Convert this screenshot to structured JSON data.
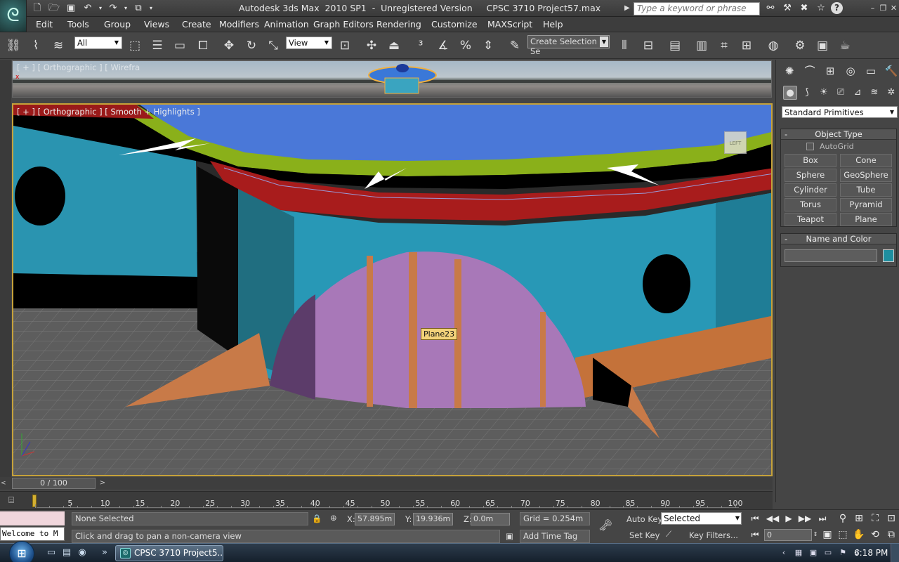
{
  "window": {
    "title": "Autodesk 3ds Max  2010 SP1  -  Unregistered Version     CPSC 3710 Project57.max",
    "search_placeholder": "Type a keyword or phrase",
    "controls": [
      "minimize-icon",
      "restore-icon",
      "close-icon"
    ]
  },
  "quick_access": [
    "new-icon",
    "open-icon",
    "save-icon",
    "undo-icon",
    "redo-icon",
    "project-folder-icon"
  ],
  "title_icons": [
    "binoculars-icon",
    "communication-center-icon",
    "favorites-icon",
    "star-icon",
    "help-icon"
  ],
  "menu": {
    "items": [
      "Edit",
      "Tools",
      "Group",
      "Views",
      "Create",
      "Modifiers",
      "Animation",
      "Graph Editors",
      "Rendering",
      "Customize",
      "MAXScript",
      "Help"
    ]
  },
  "toolbar": {
    "selection_filter": "All",
    "reference_coord": "View",
    "named_selection_set": "Create Selection Se"
  },
  "viewports": {
    "top_label": "[ + ] [ Orthographic ] [ Wirefra",
    "main_label": "[ + ] [ Orthographic ] [ Smooth + Highlights ]",
    "selected_object_tag": "Plane23",
    "viewcube_face": "LEFT"
  },
  "command_panel": {
    "primitive_type": "Standard Primitives",
    "object_type_title": "Object Type",
    "autogrid_label": "AutoGrid",
    "autogrid_checked": false,
    "primitives": [
      "Box",
      "Cone",
      "Sphere",
      "GeoSphere",
      "Cylinder",
      "Tube",
      "Torus",
      "Pyramid",
      "Teapot",
      "Plane"
    ],
    "name_color_title": "Name and Color",
    "object_name": "",
    "object_color": "#1e8fa0"
  },
  "time_slider": {
    "frame_display": "0 / 100",
    "ticks": [
      "5",
      "10",
      "15",
      "20",
      "25",
      "30",
      "35",
      "40",
      "45",
      "50",
      "55",
      "60",
      "65",
      "70",
      "75",
      "80",
      "85",
      "90",
      "95",
      "100"
    ]
  },
  "status": {
    "maxscript_output": "Welcome to M",
    "selection": "None Selected",
    "prompt": "Click and drag to pan a non-camera view",
    "x_label": "X:",
    "x_value": "57.895m",
    "y_label": "Y:",
    "y_value": "19.936m",
    "z_label": "Z:",
    "z_value": "0.0m",
    "grid": "Grid = 0.254m",
    "add_time_tag": "Add Time Tag",
    "auto_key": "Auto Key",
    "key_mode": "Selected",
    "set_key": "Set Key",
    "key_filters": "Key Filters...",
    "current_frame": "0"
  },
  "taskbar": {
    "task_label": "CPSC 3710 Project5...",
    "clock": "6:18 PM"
  }
}
